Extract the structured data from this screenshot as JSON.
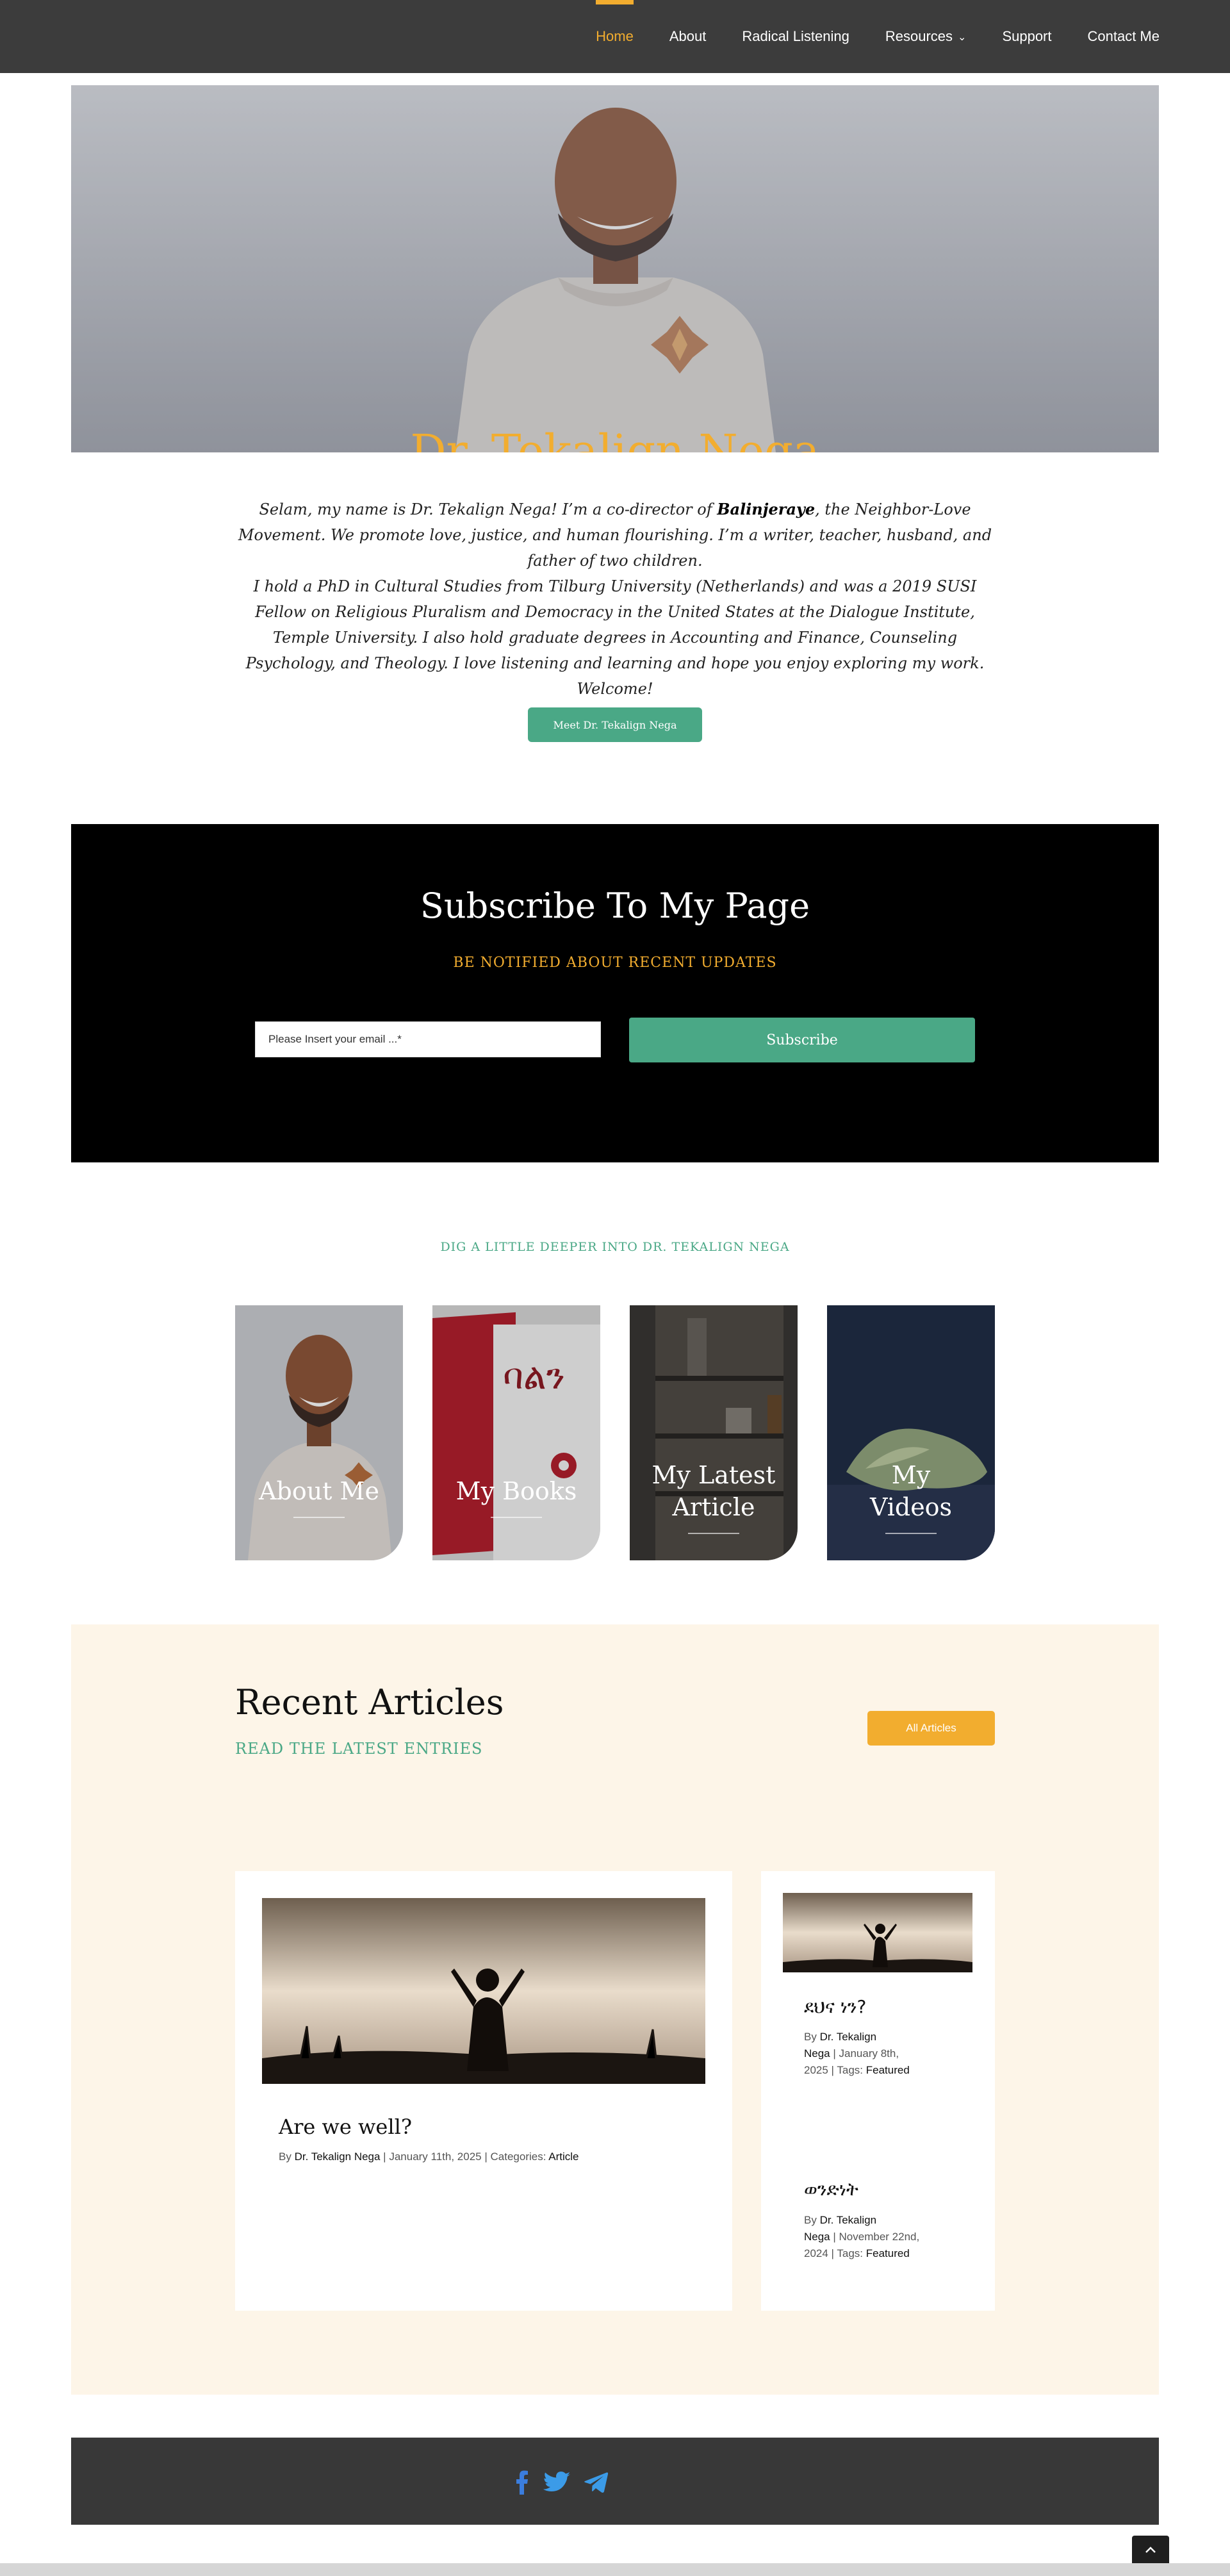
{
  "nav": {
    "items": [
      {
        "label": "Home",
        "active": true
      },
      {
        "label": "About"
      },
      {
        "label": "Radical Listening"
      },
      {
        "label": "Resources",
        "has_dropdown": true
      },
      {
        "label": "Support"
      },
      {
        "label": "Contact Me"
      }
    ]
  },
  "hero": {
    "title": "Dr. Tekalign Nega"
  },
  "intro": {
    "p1_before": "Selam, my name is Dr. Tekalign Nega! I’m a co-director of ",
    "p1_bold": "Balinjeraye",
    "p1_after": ", the Neighbor-Love Movement. We promote love, justice, and human flourishing. I’m a writer, teacher, husband, and father of two children.",
    "p2": "I hold a PhD in Cultural Studies from Tilburg University (Netherlands) and was a 2019 SUSI Fellow on Religious Pluralism and Democracy in the United States at the Dialogue Institute, Temple University. I also hold graduate degrees in Accounting and Finance, Counseling Psychology, and Theology. I love listening and learning and hope you enjoy exploring my work. Welcome!",
    "button": "Meet Dr. Tekalign Nega"
  },
  "subscribe": {
    "title": "Subscribe To My Page",
    "subtitle": "BE NOTIFIED ABOUT RECENT UPDATES",
    "placeholder": "Please Insert your email ...*",
    "button": "Subscribe"
  },
  "deeper": {
    "heading": "DIG A LITTLE DEEPER INTO  DR. TEKALIGN NEGA",
    "cards": [
      {
        "line1": "About Me",
        "line2": ""
      },
      {
        "line1": "My Books",
        "line2": ""
      },
      {
        "line1": "My Latest",
        "line2": "Article"
      },
      {
        "line1": "My",
        "line2": "Videos"
      }
    ]
  },
  "recent": {
    "title": "Recent Articles",
    "subtitle": "READ THE LATEST ENTRIES",
    "all_button": "All Articles",
    "main_article": {
      "title": "Are we well?",
      "by": "By",
      "author": "Dr. Tekalign Nega",
      "date": "January 11th, 2025",
      "cat_label": "Categories:",
      "category": "Article"
    },
    "side_articles": [
      {
        "title": "ደህና ነን?",
        "by": "By",
        "author_a": "Dr. Tekalign",
        "author_b": "Nega",
        "date_a": "January 8th,",
        "date_b": "2025",
        "tags_label": "Tags:",
        "tag": "Featured"
      },
      {
        "title": "ወንድነት",
        "by": "By",
        "author_a": "Dr. Tekalign",
        "author_b": "Nega",
        "date_a": "November 22nd,",
        "date_b": "2024",
        "tags_label": "Tags:",
        "tag": "Featured"
      }
    ]
  },
  "footer": {
    "social": [
      "facebook-icon",
      "twitter-icon",
      "telegram-icon"
    ]
  },
  "colors": {
    "accent": "#f2ad2f",
    "green": "#4aa886",
    "nav_bg": "#3c3c3c",
    "cream": "#fdf5e8"
  }
}
